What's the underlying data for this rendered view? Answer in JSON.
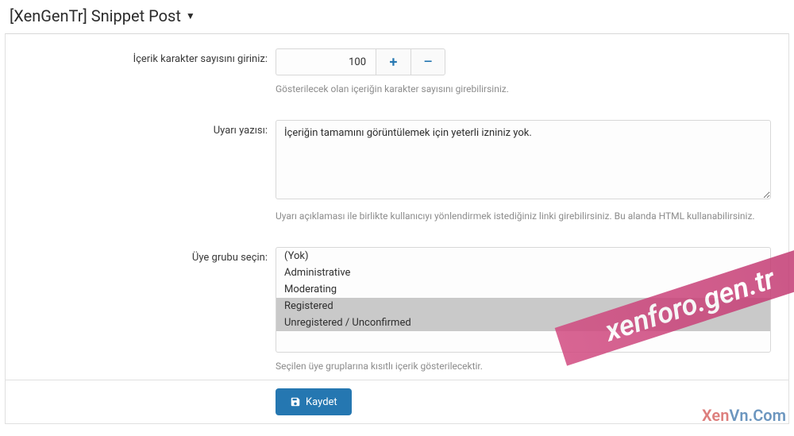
{
  "page": {
    "title": "[XenGenTr] Snippet Post"
  },
  "rows": {
    "char_count": {
      "label": "İçerik karakter sayısını giriniz:",
      "value": "100",
      "help": "Gösterilecek olan içeriğin karakter sayısını girebilirsiniz."
    },
    "warning": {
      "label": "Uyarı yazısı:",
      "value": "İçeriğin tamamını görüntülemek için yeterli izniniz yok.",
      "help": "Uyarı açıklaması ile birlikte kullanıcıyı yönlendirmek istediğiniz linki girebilirsiniz. Bu alanda HTML kullanabilirsiniz."
    },
    "groups": {
      "label": "Üye grubu seçin:",
      "options": [
        {
          "label": "(Yok)",
          "selected": false
        },
        {
          "label": "Administrative",
          "selected": false
        },
        {
          "label": "Moderating",
          "selected": false
        },
        {
          "label": "Registered",
          "selected": true
        },
        {
          "label": "Unregistered / Unconfirmed",
          "selected": true
        }
      ],
      "help": "Seçilen üye gruplarına kısıtlı içerik gösterilecektir."
    }
  },
  "buttons": {
    "save": "Kaydet"
  },
  "watermarks": {
    "diag": "xenforo.gen.tr",
    "corner_a": "Xen",
    "corner_b": "Vn.Com",
    "faded": "XenForo.gen.Tr"
  }
}
